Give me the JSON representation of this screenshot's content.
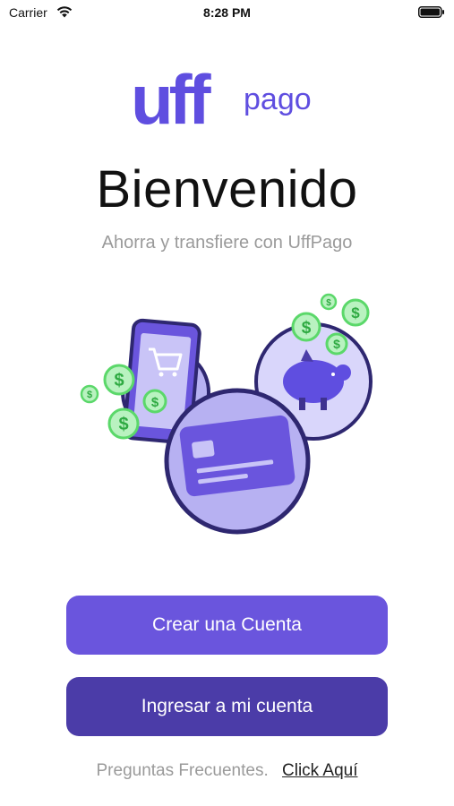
{
  "status_bar": {
    "carrier": "Carrier",
    "time": "8:28 PM",
    "wifi_icon": "wifi-icon",
    "battery_icon": "battery-icon"
  },
  "logo": {
    "brand": "uff",
    "suffix": "pago",
    "brand_color": "#5f4ee0"
  },
  "welcome": {
    "title": "Bienvenido",
    "subtitle": "Ahorra y transfiere con UffPago"
  },
  "illustration": {
    "icons": [
      "phone-cart-icon",
      "piggy-bank-icon",
      "credit-card-icon",
      "dollar-coin-icon"
    ]
  },
  "actions": {
    "create_account_label": "Crear una Cuenta",
    "login_label": "Ingresar a mi cuenta"
  },
  "faq": {
    "label": "Preguntas Frecuentes.",
    "link": "Click Aquí"
  },
  "colors": {
    "primary": "#6a55dd",
    "primary_dark": "#4b3ca8",
    "muted_text": "#9a9a9a",
    "coin_green": "#5bd86a"
  }
}
